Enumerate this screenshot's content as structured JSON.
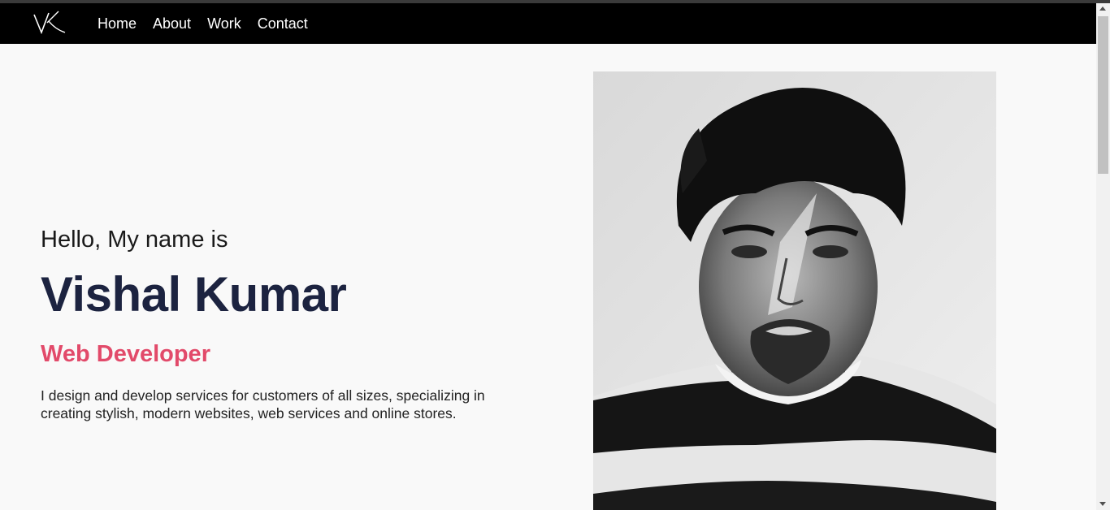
{
  "nav": {
    "logo_icon": "vk-monogram-logo",
    "links": [
      "Home",
      "About",
      "Work",
      "Contact"
    ]
  },
  "hero": {
    "greeting": "Hello, My name is",
    "name": "Vishal Kumar",
    "role": "Web Developer",
    "description": "I design and develop services for customers of all sizes, specializing in creating stylish, modern websites, web services and online stores."
  },
  "photo": {
    "alt": "portrait-photo"
  },
  "colors": {
    "nav_bg": "#000000",
    "name": "#1c2340",
    "role": "#e24a6a",
    "page_bg": "#f9f9f9"
  }
}
